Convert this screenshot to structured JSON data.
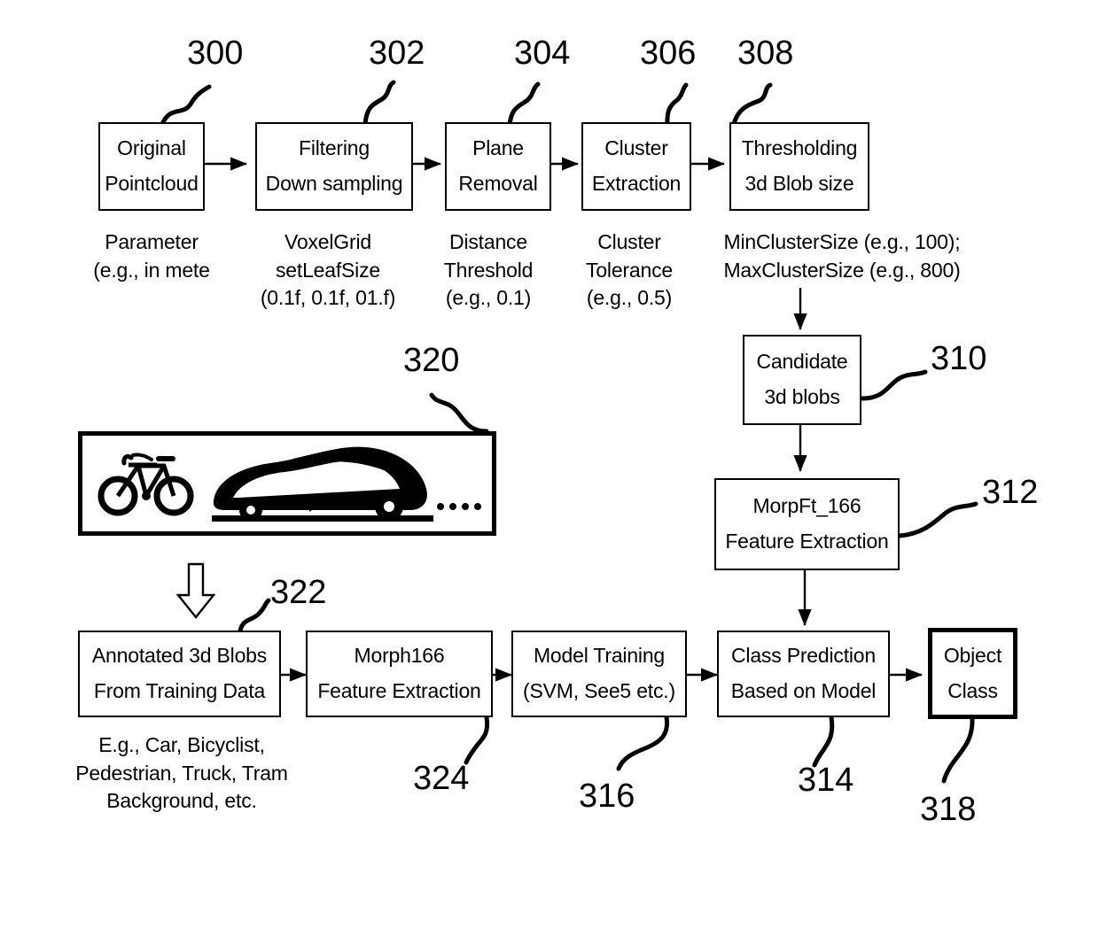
{
  "figure": {
    "type": "patent-flowchart",
    "description": "3D point cloud object classification pipeline"
  },
  "nodes": [
    {
      "id": "300",
      "lines": [
        "Original",
        "Pointcloud"
      ],
      "ref": "300"
    },
    {
      "id": "302",
      "lines": [
        "Filtering",
        "Down sampling"
      ],
      "ref": "302"
    },
    {
      "id": "304",
      "lines": [
        "Plane",
        "Removal"
      ],
      "ref": "304"
    },
    {
      "id": "306",
      "lines": [
        "Cluster",
        "Extraction"
      ],
      "ref": "306"
    },
    {
      "id": "308",
      "lines": [
        "Thresholding",
        "3d Blob size"
      ],
      "ref": "308"
    },
    {
      "id": "310",
      "lines": [
        "Candidate",
        "3d blobs"
      ],
      "ref": "310"
    },
    {
      "id": "312",
      "lines": [
        "MorpFt_166",
        "Feature Extraction"
      ],
      "ref": "312"
    },
    {
      "id": "320",
      "lines": [],
      "ref": "320"
    },
    {
      "id": "322",
      "lines": [
        "Annotated 3d Blobs",
        "From Training Data"
      ],
      "ref": "322"
    },
    {
      "id": "324",
      "lines": [
        "Morph166",
        "Feature Extraction"
      ],
      "ref": "324"
    },
    {
      "id": "316",
      "lines": [
        "Model Training",
        "(SVM, See5 etc.)"
      ],
      "ref": "316"
    },
    {
      "id": "314",
      "lines": [
        "Class Prediction",
        "Based on Model"
      ],
      "ref": "314"
    },
    {
      "id": "318",
      "lines": [
        "Object",
        "Class"
      ],
      "ref": "318"
    }
  ],
  "captions": {
    "c300": [
      "Parameter",
      "(e.g., in mete"
    ],
    "c302": [
      "VoxelGrid",
      "setLeafSize",
      "(0.1f, 0.1f, 01.f)"
    ],
    "c304": [
      "Distance",
      "Threshold",
      "(e.g., 0.1)"
    ],
    "c306": [
      "Cluster",
      "Tolerance",
      "(e.g., 0.5)"
    ],
    "c308": [
      "MinClusterSize (e.g., 100);",
      "MaxClusterSize (e.g., 800)"
    ],
    "c322": [
      "E.g., Car, Bicyclist,",
      "Pedestrian, Truck, Tram",
      "Background, etc."
    ]
  },
  "refnums": {
    "n300": "300",
    "n302": "302",
    "n304": "304",
    "n306": "306",
    "n308": "308",
    "n310": "310",
    "n312": "312",
    "n314": "314",
    "n316": "316",
    "n318": "318",
    "n320": "320",
    "n322": "322",
    "n324": "324"
  },
  "illustration": {
    "box_ref": "320",
    "items": [
      "bicycle-icon",
      "car-icon"
    ],
    "ellipsis": "• • • • • •"
  },
  "colors": {
    "stroke": "#000000",
    "background": "#ffffff"
  }
}
